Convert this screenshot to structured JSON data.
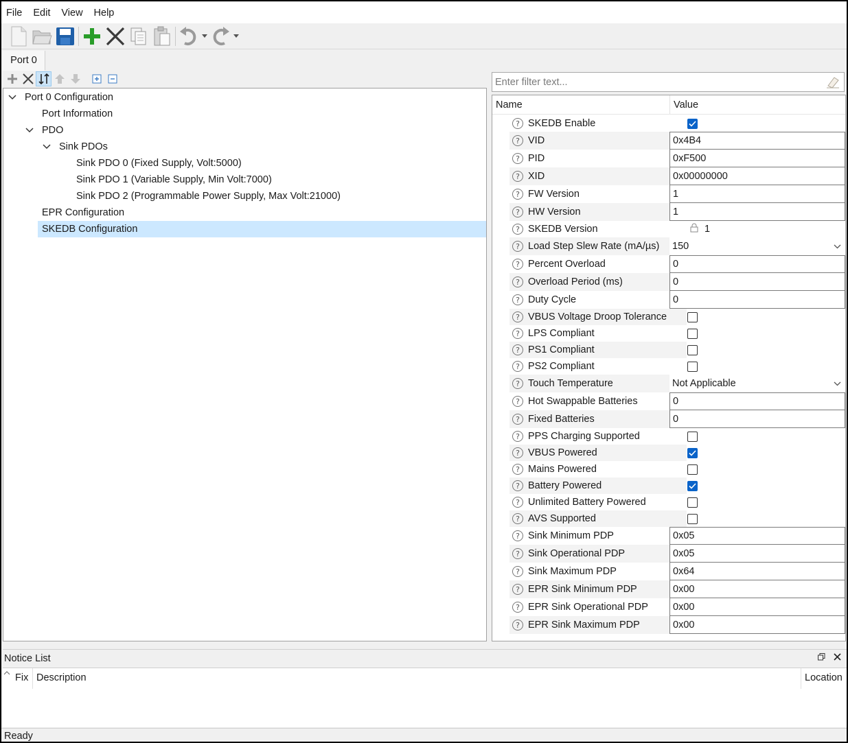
{
  "menubar": {
    "items": [
      "File",
      "Edit",
      "View",
      "Help"
    ]
  },
  "toolbar": {
    "buttons": [
      "new-file-icon",
      "open-folder-icon",
      "save-icon",
      "add-icon",
      "delete-icon",
      "copy-icon",
      "paste-icon",
      "undo-icon",
      "redo-icon"
    ]
  },
  "tabs": {
    "active": "Port 0"
  },
  "tree": {
    "nodes": [
      {
        "label": "Port 0 Configuration",
        "level": 0,
        "expanded": true
      },
      {
        "label": "Port Information",
        "level": 1
      },
      {
        "label": "PDO",
        "level": 1,
        "expanded": true
      },
      {
        "label": "Sink PDOs",
        "level": 2,
        "expanded": true
      },
      {
        "label": "Sink PDO 0 (Fixed Supply, Volt:5000)",
        "level": 3
      },
      {
        "label": "Sink PDO 1 (Variable Supply, Min Volt:7000)",
        "level": 3
      },
      {
        "label": "Sink PDO 2 (Programmable Power Supply, Max Volt:21000)",
        "level": 3
      },
      {
        "label": "EPR Configuration",
        "level": 1
      },
      {
        "label": "SKEDB Configuration",
        "level": 1,
        "selected": true
      }
    ]
  },
  "filter": {
    "placeholder": "Enter filter text..."
  },
  "grid": {
    "name_header": "Name",
    "value_header": "Value",
    "rows": [
      {
        "name": "SKEDB Enable",
        "type": "checkbox",
        "checked": true
      },
      {
        "name": "VID",
        "type": "text",
        "value": "0x4B4"
      },
      {
        "name": "PID",
        "type": "text",
        "value": "0xF500"
      },
      {
        "name": "XID",
        "type": "text",
        "value": "0x00000000"
      },
      {
        "name": "FW Version",
        "type": "text",
        "value": "1"
      },
      {
        "name": "HW Version",
        "type": "text",
        "value": "1"
      },
      {
        "name": "SKEDB Version",
        "type": "readonly",
        "value": "1"
      },
      {
        "name": "Load Step Slew Rate (mA/µs)",
        "type": "combo",
        "value": "150"
      },
      {
        "name": "Percent Overload",
        "type": "text",
        "value": "0"
      },
      {
        "name": "Overload Period (ms)",
        "type": "text",
        "value": "0"
      },
      {
        "name": "Duty Cycle",
        "type": "text",
        "value": "0"
      },
      {
        "name": "VBUS Voltage Droop Tolerance",
        "type": "checkbox",
        "checked": false
      },
      {
        "name": "LPS Compliant",
        "type": "checkbox",
        "checked": false
      },
      {
        "name": "PS1 Compliant",
        "type": "checkbox",
        "checked": false
      },
      {
        "name": "PS2 Compliant",
        "type": "checkbox",
        "checked": false
      },
      {
        "name": "Touch Temperature",
        "type": "combo",
        "value": "Not Applicable"
      },
      {
        "name": "Hot Swappable Batteries",
        "type": "text",
        "value": "0"
      },
      {
        "name": "Fixed Batteries",
        "type": "text",
        "value": "0"
      },
      {
        "name": "PPS Charging Supported",
        "type": "checkbox",
        "checked": false
      },
      {
        "name": "VBUS Powered",
        "type": "checkbox",
        "checked": true
      },
      {
        "name": "Mains Powered",
        "type": "checkbox",
        "checked": false
      },
      {
        "name": "Battery Powered",
        "type": "checkbox",
        "checked": true
      },
      {
        "name": "Unlimited Battery Powered",
        "type": "checkbox",
        "checked": false
      },
      {
        "name": "AVS Supported",
        "type": "checkbox",
        "checked": false
      },
      {
        "name": "Sink Minimum PDP",
        "type": "text",
        "value": "0x05"
      },
      {
        "name": "Sink Operational PDP",
        "type": "text",
        "value": "0x05"
      },
      {
        "name": "Sink Maximum PDP",
        "type": "text",
        "value": "0x64"
      },
      {
        "name": "EPR Sink Minimum PDP",
        "type": "text",
        "value": "0x00"
      },
      {
        "name": "EPR Sink Operational PDP",
        "type": "text",
        "value": "0x00"
      },
      {
        "name": "EPR Sink Maximum PDP",
        "type": "text",
        "value": "0x00"
      }
    ]
  },
  "notice": {
    "title": "Notice List",
    "col_fix": "Fix",
    "col_description": "Description",
    "col_location": "Location"
  },
  "status": {
    "text": "Ready"
  },
  "colors": {
    "accent": "#0a63c9",
    "selection": "#cce8ff",
    "add_green": "#2a9d2a"
  }
}
